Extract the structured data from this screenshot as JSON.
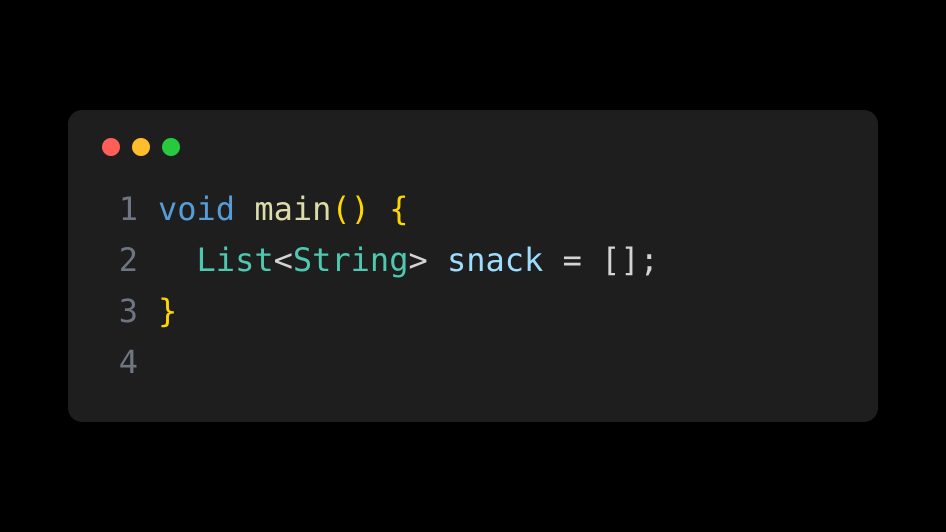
{
  "window": {
    "traffic_lights": {
      "red": "#ff5f56",
      "yellow": "#ffbd2e",
      "green": "#27c93f"
    }
  },
  "code": {
    "lines": [
      {
        "num": "1",
        "tokens": {
          "t0": "void",
          "t1": " ",
          "t2": "main",
          "t3": "()",
          "t4": " ",
          "t5": "{"
        }
      },
      {
        "num": "2",
        "tokens": {
          "indent": "  ",
          "t0": "List",
          "t1": "<",
          "t2": "String",
          "t3": ">",
          "t4": " ",
          "t5": "snack",
          "t6": " ",
          "t7": "=",
          "t8": " ",
          "t9": "[]",
          "t10": ";"
        }
      },
      {
        "num": "3",
        "tokens": {
          "t0": "}"
        }
      },
      {
        "num": "4",
        "tokens": {}
      }
    ]
  }
}
